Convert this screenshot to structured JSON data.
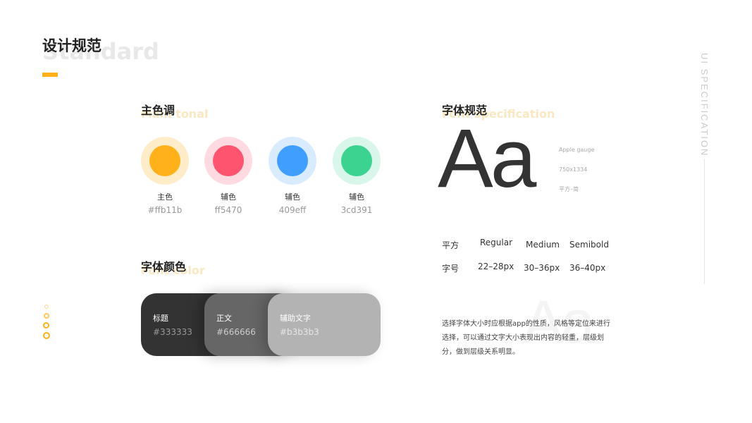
{
  "header": {
    "title": "设计规范",
    "background_word": "Standard",
    "accent": "#ffb11b"
  },
  "primary_colors": {
    "title": "主色调",
    "title_en": "Main tonal",
    "swatches": [
      {
        "name": "主色",
        "code": "#ffb11b",
        "color": "#ffb11b",
        "ring": "#ffecc8"
      },
      {
        "name": "辅色",
        "code": "ff5470",
        "color": "#ff5470",
        "ring": "#ffdbe1"
      },
      {
        "name": "辅色",
        "code": "409eff",
        "color": "#409eff",
        "ring": "#d9ebff"
      },
      {
        "name": "辅色",
        "code": "3cd391",
        "color": "#3cd391",
        "ring": "#d8f6e9"
      }
    ]
  },
  "font_colors": {
    "title": "字体颜色",
    "title_en": "Font color",
    "cards": [
      {
        "label": "标题",
        "code": "#333333",
        "bg": "#333333",
        "code_color": "#999999"
      },
      {
        "label": "正文",
        "code": "#666666",
        "bg": "#666666",
        "code_color": "#cccccc"
      },
      {
        "label": "辅助文字",
        "code": "#b3b3b3",
        "bg": "#b3b3b3",
        "code_color": "#e6e6e6"
      }
    ]
  },
  "font_spec": {
    "title": "字体规范",
    "title_en": "Font specification",
    "sample": "Aa",
    "meta": [
      "Apple gauge",
      "750x1334",
      "平方–简"
    ],
    "rows": [
      [
        "平方",
        "Regular",
        "Medium",
        "Semibold"
      ],
      [
        "字号",
        "22–28px",
        "30–36px",
        "36–40px"
      ]
    ],
    "ghost": "Aa",
    "description": "选择字体大小时应根据app的性质，风格等定位来进行选择，可以通过文字大小表现出内容的轻重，层级划分，做到层级关系明显。"
  },
  "side": {
    "label": "UI SPECIFICATION"
  }
}
